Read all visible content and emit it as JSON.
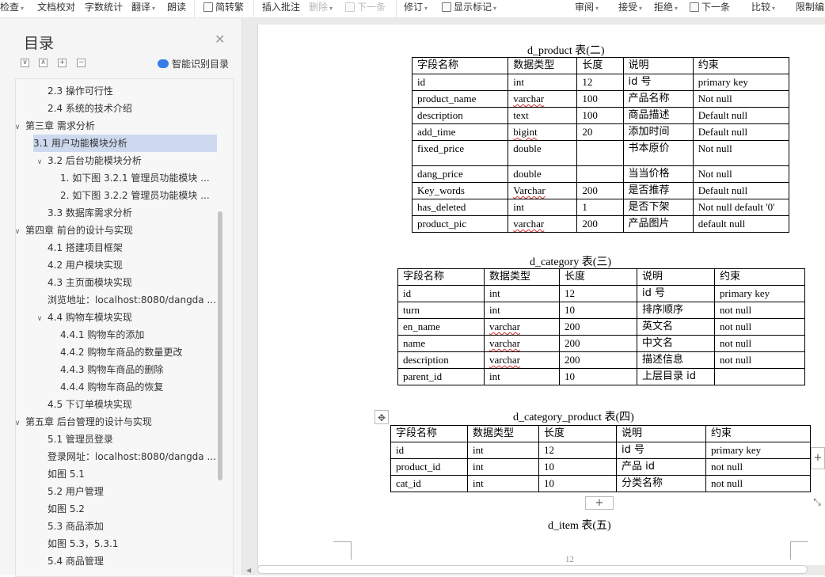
{
  "toolbar": {
    "items": [
      {
        "label": "检查",
        "caret": true
      },
      {
        "label": "文档校对"
      },
      {
        "label": "字数统计"
      },
      {
        "label": "翻译",
        "caret": true
      },
      {
        "label": "朗读"
      },
      {
        "label": "简转繁"
      },
      {
        "label": "插入批注"
      },
      {
        "label": "删除",
        "caret": true
      },
      {
        "label": "下一条"
      },
      {
        "label": "修订",
        "caret": true
      },
      {
        "label": "显示标记",
        "caret": true
      },
      {
        "label": "审阅",
        "caret": true
      },
      {
        "label": "接受",
        "caret": true
      },
      {
        "label": "拒绝",
        "caret": true
      },
      {
        "label": "下一条"
      },
      {
        "label": "比较",
        "caret": true
      },
      {
        "label": "限制编"
      }
    ]
  },
  "nav": {
    "title": "目录",
    "smart_label": "智能识别目录",
    "items": [
      {
        "label": "2.3  操作可行性",
        "level": 2
      },
      {
        "label": "2.4  系统的技术介绍",
        "level": 2
      },
      {
        "label": "第三章  需求分析",
        "level": 1,
        "arrow": "down"
      },
      {
        "label": "3.1  用户功能模块分析",
        "level": 2,
        "selected": true
      },
      {
        "label": "3.2  后台功能模块分析",
        "level": 2,
        "arrow": "down"
      },
      {
        "label": "1. 如下图 3.2.1 管理员功能模块 ...",
        "level": 3
      },
      {
        "label": "2. 如下图 3.2.2 管理员功能模块 ...",
        "level": 3
      },
      {
        "label": "3.3  数据库需求分析",
        "level": 2
      },
      {
        "label": "第四章  前台的设计与实现",
        "level": 1,
        "arrow": "down"
      },
      {
        "label": "4.1  搭建项目框架",
        "level": 2
      },
      {
        "label": "4.2  用户模块实现",
        "level": 2
      },
      {
        "label": "4.3  主页面模块实现",
        "level": 2
      },
      {
        "label": "浏览地址：localhost:8080/dangda ...",
        "level": 2
      },
      {
        "label": "4.4  购物车模块实现",
        "level": 2,
        "arrow": "down"
      },
      {
        "label": "4.4.1  购物车的添加",
        "level": 3
      },
      {
        "label": "4.4.2  购物车商品的数量更改",
        "level": 3
      },
      {
        "label": "4.4.3  购物车商品的删除",
        "level": 3
      },
      {
        "label": "4.4.4  购物车商品的恢复",
        "level": 3
      },
      {
        "label": "4.5  下订单模块实现",
        "level": 2
      },
      {
        "label": "第五章  后台管理的设计与实现",
        "level": 1,
        "arrow": "down"
      },
      {
        "label": "5.1 管理员登录",
        "level": 2
      },
      {
        "label": "登录网址：localhost:8080/dangda ...",
        "level": 2
      },
      {
        "label": "如图 5.1",
        "level": 2
      },
      {
        "label": "5.2  用户管理",
        "level": 2
      },
      {
        "label": "如图 5.2",
        "level": 2
      },
      {
        "label": "5.3  商品添加",
        "level": 2
      },
      {
        "label": "如图 5.3，5.3.1",
        "level": 2
      },
      {
        "label": "5.4  商品管理",
        "level": 2
      }
    ]
  },
  "doc": {
    "page_number": "12",
    "tables": [
      {
        "caption": "d_product 表(二)",
        "rows": [
          [
            "字段名称",
            "数据类型",
            "长度",
            "说明",
            "约束"
          ],
          [
            "id",
            "int",
            "12",
            "id 号",
            "primary key"
          ],
          [
            "product_name",
            "varchar",
            "100",
            "产品名称",
            "Not null"
          ],
          [
            "description",
            "text",
            "100",
            "商品描述",
            "Default null"
          ],
          [
            "add_time",
            "bigint",
            "20",
            "添加时间",
            "Default null"
          ],
          [
            "fixed_price",
            "double",
            "",
            "书本原价",
            "Not null"
          ],
          [
            "dang_price",
            "double",
            "",
            "当当价格",
            "Not null"
          ],
          [
            "Key_words",
            "Varchar",
            "200",
            "是否推荐",
            "Default null"
          ],
          [
            "has_deleted",
            "int",
            "1",
            "是否下架",
            "Not null default '0'"
          ],
          [
            "product_pic",
            "varchar",
            "200",
            "产品图片",
            "default null"
          ]
        ]
      },
      {
        "caption": "d_category 表(三)",
        "rows": [
          [
            "字段名称",
            "数据类型",
            "长度",
            "说明",
            "约束"
          ],
          [
            "id",
            "int",
            "12",
            "id 号",
            "primary key"
          ],
          [
            "turn",
            "int",
            "10",
            "排序顺序",
            "not null"
          ],
          [
            "en_name",
            "varchar",
            "200",
            "英文名",
            "not null"
          ],
          [
            "name",
            "varchar",
            "200",
            "中文名",
            "not null"
          ],
          [
            "description",
            "varchar",
            "200",
            "描述信息",
            "not null"
          ],
          [
            "parent_id",
            "int",
            "10",
            "上层目录 id",
            ""
          ]
        ]
      },
      {
        "caption": "d_category_product 表(四)",
        "rows": [
          [
            "字段名称",
            "数据类型",
            "长度",
            "说明",
            "约束"
          ],
          [
            "id",
            "int",
            "12",
            "id 号",
            "primary key"
          ],
          [
            "product_id",
            "int",
            "10",
            "产品 id",
            "not null"
          ],
          [
            "cat_id",
            "int",
            "10",
            "分类名称",
            "not null"
          ]
        ]
      }
    ],
    "next_caption": "d_item 表(五)"
  }
}
